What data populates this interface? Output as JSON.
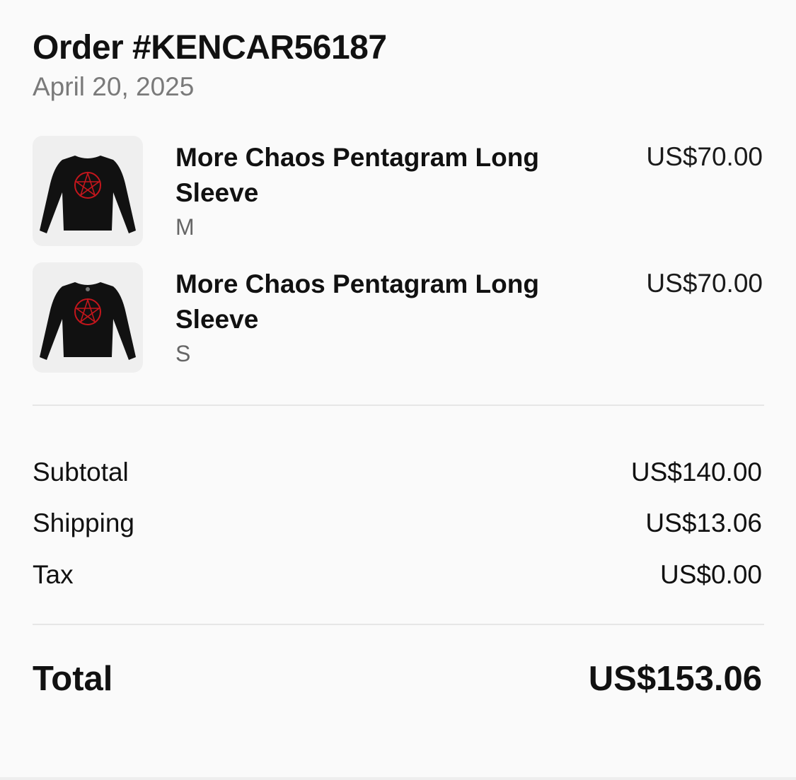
{
  "order": {
    "title": "Order #KENCAR56187",
    "date": "April 20, 2025"
  },
  "items": [
    {
      "name": "More Chaos Pentagram Long Sleeve",
      "variant": "M",
      "price": "US$70.00",
      "thumbnail_icon": "long-sleeve-shirt-icon"
    },
    {
      "name": "More Chaos Pentagram Long Sleeve",
      "variant": "S",
      "price": "US$70.00",
      "thumbnail_icon": "long-sleeve-shirt-icon"
    }
  ],
  "summary": {
    "subtotal_label": "Subtotal",
    "subtotal_value": "US$140.00",
    "shipping_label": "Shipping",
    "shipping_value": "US$13.06",
    "tax_label": "Tax",
    "tax_value": "US$0.00",
    "total_label": "Total",
    "total_value": "US$153.06"
  },
  "colors": {
    "background": "#fafafa",
    "thumbnail_bg": "#efefef",
    "shirt": "#111111",
    "pentagram": "#c4161c",
    "muted_text": "#7a7a7a",
    "divider": "#e6e6e6"
  }
}
